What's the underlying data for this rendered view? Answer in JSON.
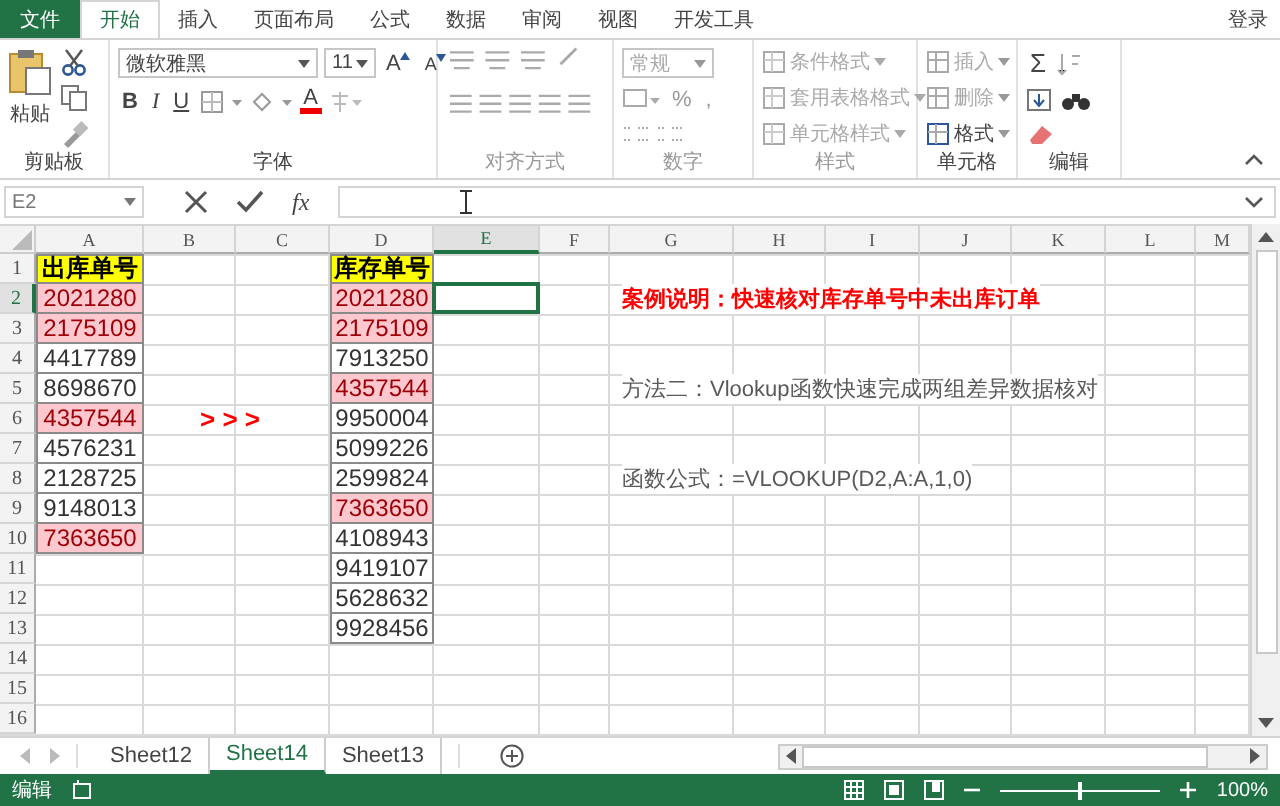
{
  "ribbon_tabs": [
    {
      "label": "文件",
      "kind": "file",
      "selected": false
    },
    {
      "label": "开始",
      "kind": "tab",
      "selected": true
    },
    {
      "label": "插入",
      "kind": "tab",
      "selected": false
    },
    {
      "label": "页面布局",
      "kind": "tab",
      "selected": false
    },
    {
      "label": "公式",
      "kind": "tab",
      "selected": false
    },
    {
      "label": "数据",
      "kind": "tab",
      "selected": false
    },
    {
      "label": "审阅",
      "kind": "tab",
      "selected": false
    },
    {
      "label": "视图",
      "kind": "tab",
      "selected": false
    },
    {
      "label": "开发工具",
      "kind": "tab",
      "selected": false
    }
  ],
  "account": "登录",
  "ribbon_groups": [
    {
      "kind": "clipboard",
      "label": "剪贴板",
      "disabled": false,
      "paste": "粘贴"
    },
    {
      "kind": "font",
      "label": "字体",
      "disabled": false,
      "font_name": "微软雅黑",
      "font_size": "11",
      "grow": "A",
      "shrink": "A",
      "bold": "B",
      "italic": "I",
      "underline": "U",
      "font_color": "A"
    },
    {
      "kind": "alignment",
      "label": "对齐方式",
      "disabled": true
    },
    {
      "kind": "number",
      "label": "数字",
      "disabled": true,
      "format": "常规",
      "percent": "%",
      "comma": ","
    },
    {
      "kind": "styles",
      "label": "样式",
      "disabled": true,
      "commands": [
        "条件格式",
        "套用表格格式",
        "单元格样式"
      ]
    },
    {
      "kind": "cells",
      "label": "单元格",
      "disabled": false,
      "commands": [
        {
          "label": "插入",
          "disabled": true
        },
        {
          "label": "删除",
          "disabled": true
        },
        {
          "label": "格式",
          "disabled": false
        }
      ]
    },
    {
      "kind": "editing",
      "label": "编辑",
      "disabled": false,
      "sum": "Σ"
    }
  ],
  "formula_bar": {
    "name_box": "E2",
    "function_label": "fx"
  },
  "columns": [
    {
      "letter": "A",
      "selected": false
    },
    {
      "letter": "B",
      "selected": false
    },
    {
      "letter": "C",
      "selected": false
    },
    {
      "letter": "D",
      "selected": false
    },
    {
      "letter": "E",
      "selected": true
    },
    {
      "letter": "F",
      "selected": false
    },
    {
      "letter": "G",
      "selected": false
    },
    {
      "letter": "H",
      "selected": false
    },
    {
      "letter": "I",
      "selected": false
    },
    {
      "letter": "J",
      "selected": false
    },
    {
      "letter": "K",
      "selected": false
    },
    {
      "letter": "L",
      "selected": false
    },
    {
      "letter": "M",
      "selected": false
    }
  ],
  "rows": [
    {
      "number": "1",
      "selected": false,
      "cells": {
        "A": {
          "kind": "header",
          "text": "出库单号"
        },
        "D": {
          "kind": "header",
          "text": "库存单号"
        }
      }
    },
    {
      "number": "2",
      "selected": true,
      "cells": {
        "A": {
          "kind": "number",
          "text": "2021280",
          "highlighted": true
        },
        "D": {
          "kind": "number",
          "text": "2021280",
          "highlighted": true
        },
        "G": {
          "kind": "note",
          "text": "案例说明：快速核对库存单号中未出库订单",
          "emphasis": true
        }
      }
    },
    {
      "number": "3",
      "selected": false,
      "cells": {
        "A": {
          "kind": "number",
          "text": "2175109",
          "highlighted": true
        },
        "D": {
          "kind": "number",
          "text": "2175109",
          "highlighted": true
        }
      }
    },
    {
      "number": "4",
      "selected": false,
      "cells": {
        "A": {
          "kind": "number",
          "text": "4417789",
          "highlighted": false
        },
        "D": {
          "kind": "number",
          "text": "7913250",
          "highlighted": false
        }
      }
    },
    {
      "number": "5",
      "selected": false,
      "cells": {
        "A": {
          "kind": "number",
          "text": "8698670",
          "highlighted": false
        },
        "D": {
          "kind": "number",
          "text": "4357544",
          "highlighted": true
        },
        "G": {
          "kind": "note",
          "text": "方法二：Vlookup函数快速完成两组差异数据核对",
          "emphasis": false
        }
      }
    },
    {
      "number": "6",
      "selected": false,
      "cells": {
        "A": {
          "kind": "number",
          "text": "4357544",
          "highlighted": true
        },
        "B": {
          "kind": "arrows",
          "text": "> > >"
        },
        "D": {
          "kind": "number",
          "text": "9950004",
          "highlighted": false
        }
      }
    },
    {
      "number": "7",
      "selected": false,
      "cells": {
        "A": {
          "kind": "number",
          "text": "4576231",
          "highlighted": false
        },
        "D": {
          "kind": "number",
          "text": "5099226",
          "highlighted": false
        }
      }
    },
    {
      "number": "8",
      "selected": false,
      "cells": {
        "A": {
          "kind": "number",
          "text": "2128725",
          "highlighted": false
        },
        "D": {
          "kind": "number",
          "text": "2599824",
          "highlighted": false
        },
        "G": {
          "kind": "note",
          "text": "函数公式：=VLOOKUP(D2,A:A,1,0)",
          "emphasis": false
        }
      }
    },
    {
      "number": "9",
      "selected": false,
      "cells": {
        "A": {
          "kind": "number",
          "text": "9148013",
          "highlighted": false
        },
        "D": {
          "kind": "number",
          "text": "7363650",
          "highlighted": true
        }
      }
    },
    {
      "number": "10",
      "selected": false,
      "cells": {
        "A": {
          "kind": "number",
          "text": "7363650",
          "highlighted": true
        },
        "D": {
          "kind": "number",
          "text": "4108943",
          "highlighted": false
        }
      }
    },
    {
      "number": "11",
      "selected": false,
      "cells": {
        "D": {
          "kind": "number",
          "text": "9419107",
          "highlighted": false
        }
      }
    },
    {
      "number": "12",
      "selected": false,
      "cells": {
        "D": {
          "kind": "number",
          "text": "5628632",
          "highlighted": false
        }
      }
    },
    {
      "number": "13",
      "selected": false,
      "cells": {
        "D": {
          "kind": "number",
          "text": "9928456",
          "highlighted": false
        }
      }
    },
    {
      "number": "14",
      "selected": false,
      "cells": {}
    },
    {
      "number": "15",
      "selected": false,
      "cells": {}
    },
    {
      "number": "16",
      "selected": false,
      "cells": {}
    }
  ],
  "sheet_tabs": [
    {
      "label": "Sheet12",
      "selected": false
    },
    {
      "label": "Sheet14",
      "selected": true
    },
    {
      "label": "Sheet13",
      "selected": false
    }
  ],
  "status_bar": {
    "mode": "编辑",
    "zoom": "100%",
    "zoom_slider": {
      "level": 0.5
    }
  }
}
